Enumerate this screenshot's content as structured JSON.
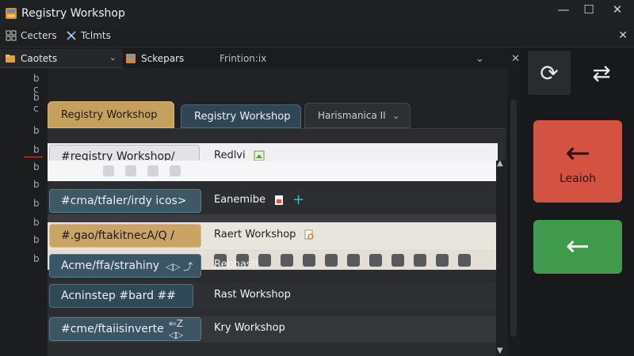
{
  "window": {
    "title": "Registry Workshop",
    "controls": {
      "minimize": "—",
      "maximize": "☐",
      "close": "✕"
    }
  },
  "menubar": {
    "items": [
      {
        "label": "Cecters",
        "icon": "grid-icon"
      },
      {
        "label": "Tclmts",
        "icon": "tools-icon"
      }
    ],
    "close": "✕"
  },
  "toolbar": {
    "dropdown_label": "Caotets",
    "dropdown_chevron": "⌄",
    "tab2_label": "Sckepars",
    "tab3_label": "Frintion:ix",
    "controls": [
      "⌄",
      "✕"
    ]
  },
  "gutter": {
    "lines": [
      "b c",
      "b c",
      "b",
      "b",
      "b",
      "b",
      "b",
      "b",
      "b",
      "b"
    ]
  },
  "tabs": [
    {
      "label": "Registry Workshop",
      "active": true
    },
    {
      "label": "Registry Workshop",
      "active": false
    },
    {
      "label": "Harismanica II",
      "suffix": "⌄",
      "active": false
    }
  ],
  "rows": [
    {
      "path": "#registry Workshop/",
      "right": "Redlvi"
    },
    {
      "path": "#cma/tfaler/irdy icos>",
      "right": "Eanemibe"
    },
    {
      "path": "#.gao/ftakitnecA/Q /",
      "right": "Raert Workshop"
    },
    {
      "path": "Acme/ffa/strahiny",
      "right": "Repnash"
    },
    {
      "path": "Acninstep #bard ##",
      "right": "Rast Workshop"
    },
    {
      "path": "#cme/ftaiisinverte",
      "right": "Kry Workshop"
    }
  ],
  "row4_glyphs": "◁▷ ⤴",
  "row6_glyphs": "⇐Z ◁▷",
  "right_panel": {
    "top_buttons": [
      {
        "name": "refresh-icon",
        "glyph": "⟳"
      },
      {
        "name": "swap-icon",
        "glyph": "⇄"
      }
    ],
    "red_button": {
      "arrow": "←",
      "label": "Leaioh"
    },
    "green_button": {
      "arrow": "←"
    }
  },
  "colors": {
    "accent_gold": "#c5a05c",
    "accent_teal": "#3e5866",
    "danger": "#d45242",
    "success": "#3f9a4c"
  }
}
